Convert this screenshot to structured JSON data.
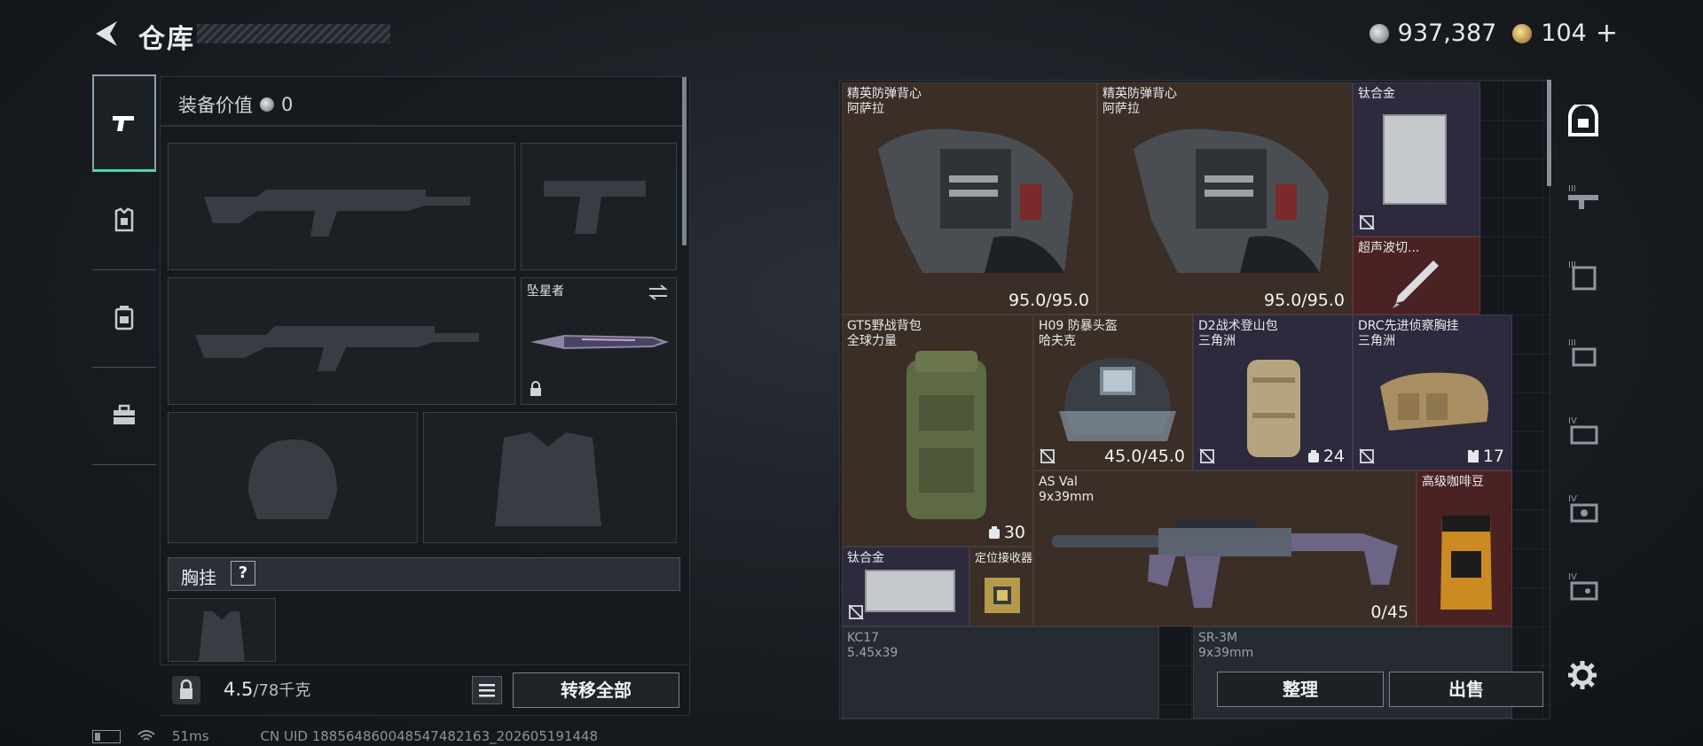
{
  "header": {
    "title": "仓库"
  },
  "currency": {
    "silver_amount": "937,387",
    "gold_amount": "104",
    "plus": "+"
  },
  "rail": {
    "items": [
      "weapon-category",
      "armor-category",
      "backpack-category",
      "toolbox-category"
    ]
  },
  "loadout": {
    "equip_value_label": "装备价值",
    "equip_value": "0",
    "melee_slot_label": "坠星者",
    "chest_rig_label": "胸挂",
    "chest_rig_help": "?",
    "weight_current": "4.5",
    "weight_max": "/78千克",
    "transfer_all": "转移全部"
  },
  "storage": {
    "items": [
      {
        "name": "精英防弹背心\n阿萨拉",
        "value": "95.0/95.0",
        "color": "brown"
      },
      {
        "name": "精英防弹背心\n阿萨拉",
        "value": "95.0/95.0",
        "color": "brown"
      },
      {
        "name": "钛合金",
        "color": "purple"
      },
      {
        "name": "超声波切...",
        "color": "red"
      },
      {
        "name": "GT5野战背包\n全球力量",
        "count": "30",
        "color": "brown"
      },
      {
        "name": "H09 防暴头盔\n哈夫克",
        "value": "45.0/45.0",
        "color": "brown"
      },
      {
        "name": "D2战术登山包\n三角洲",
        "count": "24",
        "color": "purple"
      },
      {
        "name": "DRC先进侦察胸挂\n三角洲",
        "count": "17",
        "color": "purple"
      },
      {
        "name": "AS Val\n9x39mm",
        "value": "0/45",
        "color": "brown"
      },
      {
        "name": "高级咖啡豆",
        "color": "red"
      },
      {
        "name": "钛合金",
        "color": "purple"
      },
      {
        "name": "定位接收器",
        "color": "brown"
      },
      {
        "name": "KC17\n5.45x39",
        "color": "grey"
      },
      {
        "name": "SR-3M\n9x39mm",
        "color": "grey"
      }
    ],
    "sort_label": "整理",
    "sell_label": "出售"
  },
  "status": {
    "ping": "51ms",
    "uid": "CN UID 18856486004854748​2163_202605191448"
  },
  "colors": {
    "accent": "#4fd9a0",
    "brown_cell": "#3b2e26",
    "purple_cell": "#2c2a3c",
    "red_cell": "#4a2224"
  }
}
